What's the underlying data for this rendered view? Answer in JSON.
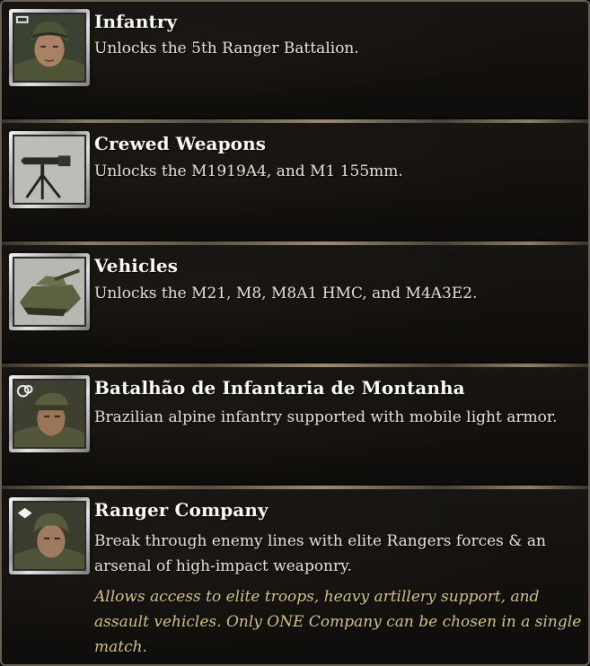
{
  "items": [
    {
      "title": "Infantry",
      "description": "Unlocks the 5th Ranger Battalion.",
      "icon": "infantry-soldier-icon"
    },
    {
      "title": "Crewed Weapons",
      "description": "Unlocks the M1919A4, and M1 155mm.",
      "icon": "machine-gun-icon"
    },
    {
      "title": "Vehicles",
      "description": "Unlocks the M21, M8, M8A1 HMC, and M4A3E2.",
      "icon": "tank-icon"
    },
    {
      "title": "Batalhão de Infantaria de Montanha",
      "description": "Brazilian alpine infantry supported with mobile light armor.",
      "icon": "alpine-soldier-icon"
    },
    {
      "title": "Ranger Company",
      "description": "Break through enemy lines with elite Rangers forces & an arsenal of high-impact weaponry.",
      "note": "Allows access to elite troops, heavy artillery support, and assault vehicles. Only ONE Company can be chosen in a single match.",
      "icon": "ranger-soldier-icon"
    }
  ],
  "colors": {
    "title": "#ffffff",
    "description": "#ece6da",
    "note": "#d8c77a",
    "background": "#0b0a09"
  }
}
